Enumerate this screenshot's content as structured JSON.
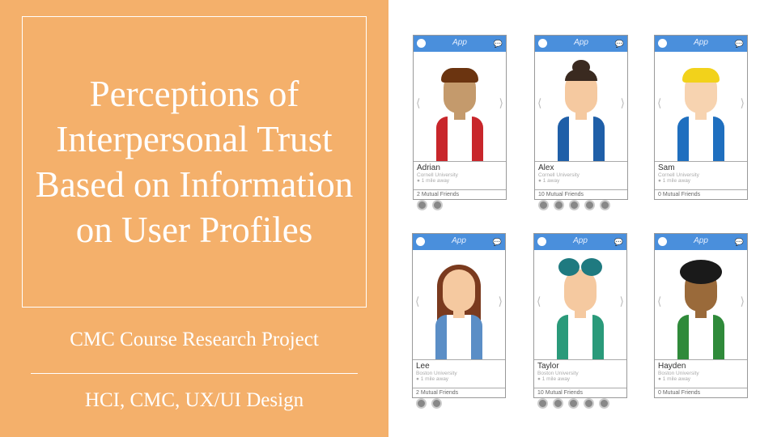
{
  "slide": {
    "title": "Perceptions of Interpersonal Trust Based on Information on User Profiles",
    "subtitle": "CMC Course Research Project",
    "tags": "HCI, CMC, UX/UI Design",
    "background": "#f4b06b"
  },
  "app": {
    "name": "App",
    "header_color": "#4a8fdc",
    "chat_icon": "chat-bubbles-icon",
    "profile_icon": "user-circle-icon"
  },
  "cards": [
    {
      "name": "Adrian",
      "university": "Cornell University",
      "distance": "1 mile away",
      "mutual": "2 Mutual Friends",
      "friend_count": 2,
      "hair": "#6b3410",
      "skin": "#c49a6c",
      "vest": "#c8262b",
      "style": "short"
    },
    {
      "name": "Alex",
      "university": "Cornell University",
      "distance": "1 away",
      "mutual": "10 Mutual Friends",
      "friend_count": 5,
      "hair": "#3a2a20",
      "skin": "#f5c9a0",
      "vest": "#1f5fa8",
      "style": "bun"
    },
    {
      "name": "Sam",
      "university": "Cornell University",
      "distance": "1 mile away",
      "mutual": "0 Mutual Friends",
      "friend_count": 0,
      "hair": "#f2d21b",
      "skin": "#f7d3b0",
      "vest": "#1f6fbf",
      "style": "short"
    },
    {
      "name": "Lee",
      "university": "Boston University",
      "distance": "1 mile away",
      "mutual": "2 Mutual Friends",
      "friend_count": 2,
      "hair": "#7a3a1e",
      "skin": "#f5c9a0",
      "vest": "#5b8ec6",
      "style": "long"
    },
    {
      "name": "Taylor",
      "university": "Boston University",
      "distance": "1 mile away",
      "mutual": "10 Mutual Friends",
      "friend_count": 5,
      "hair": "#1f7a80",
      "skin": "#f5c9a0",
      "vest": "#2a9a7a",
      "style": "puffs"
    },
    {
      "name": "Hayden",
      "university": "Boston University",
      "distance": "1 mile away",
      "mutual": "0 Mutual Friends",
      "friend_count": 0,
      "hair": "#1a1a1a",
      "skin": "#9a6a3a",
      "vest": "#2f8a3a",
      "style": "curly"
    }
  ]
}
